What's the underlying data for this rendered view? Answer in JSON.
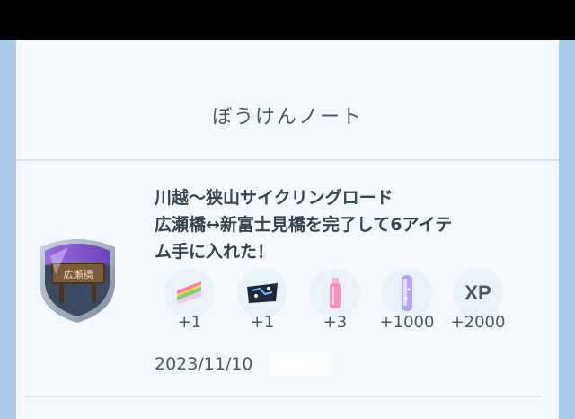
{
  "screen_title": "ぼうけんノート",
  "entry": {
    "line1": "川越〜狭山サイクリングロード",
    "line2": "広瀬橋↔新富士見橋を完了して6アイテ",
    "line3": "ム手に入れた！",
    "date": "2023/11/10",
    "badge_text": "広瀬橋",
    "rewards": [
      {
        "icon": "rainbow-cake-icon",
        "amount": "+1"
      },
      {
        "icon": "route-map-icon",
        "amount": "+1"
      },
      {
        "icon": "pink-potion-icon",
        "amount": "+3"
      },
      {
        "icon": "stardust-canister-icon",
        "amount": "+1000"
      },
      {
        "icon": "xp-icon",
        "label": "XP",
        "amount": "+2000"
      }
    ]
  },
  "colors": {
    "accent_purple": "#8a5fd3",
    "panel": "#f4f8fc",
    "text": "#4b5964"
  }
}
